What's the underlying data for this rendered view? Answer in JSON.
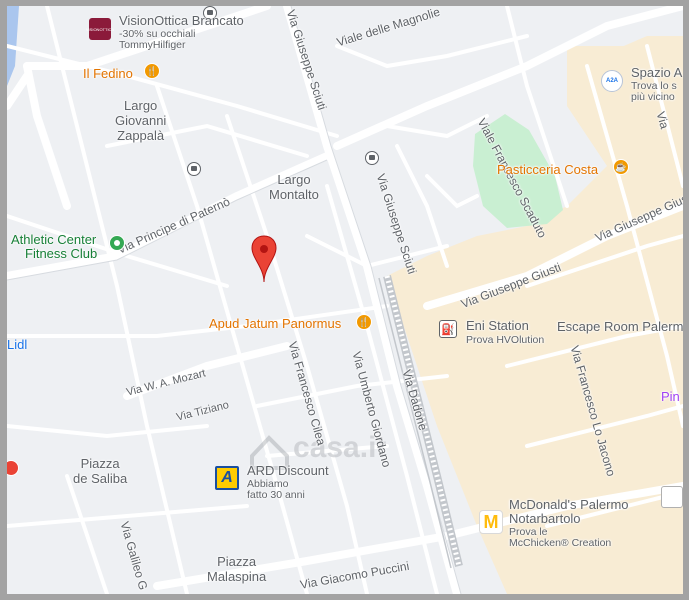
{
  "streets": {
    "viale_delle_magnolie": "Viale delle Magnolie",
    "via_giuseppe_sciuti_top": "Via Giuseppe Sciuti",
    "via_giuseppe_sciuti_mid": "Via Giuseppe Sciuti",
    "via_principe_di_paterno": "Via Principe di Paternò",
    "viale_francesco_scaduto": "Viale Francesco Scaduto",
    "via_giuseppe_giusti": "Via Giuseppe Giusti",
    "via_francesco_cilea": "Via Francesco Cilea",
    "via_umberto_giordano": "Via Umberto Giordano",
    "via_dadone": "Via Dadone",
    "via_w_a_mozart": "Via W. A. Mozart",
    "via_tiziano": "Via Tiziano",
    "via_francesco_lo_jacono": "Via Francesco Lo Jacono",
    "via_giacomo_puccini": "Via Giacomo Puccini",
    "via_galileo": "Via Galileo G",
    "via_right_edge": "Via"
  },
  "areas": {
    "largo_giovanni_zappala": [
      "Largo",
      "Giovanni",
      "Zappalà"
    ],
    "largo_montalto": [
      "Largo",
      "Montalto"
    ],
    "piazza_de_saliba": [
      "Piazza",
      "de Saliba"
    ],
    "piazza_malaspina": [
      "Piazza",
      "Malaspina"
    ]
  },
  "pois": {
    "vision_ottica": {
      "name": "VisionOttica Brancato",
      "sub1": "-30% su occhiali",
      "sub2": "TommyHilfiger",
      "logo_text": "VISIONOTTICA"
    },
    "il_fedino": {
      "name": "Il Fedino"
    },
    "spazio": {
      "name": "Spazio A",
      "sub1": "Trova lo s",
      "sub2": "più vicino",
      "logo_text": "A2A"
    },
    "pasticceria_costa": {
      "name": "Pasticceria Costa"
    },
    "athletic_center": {
      "name1": "Athletic Center",
      "name2": "Fitness Club"
    },
    "apud_jatum": {
      "name": "Apud Jatum Panormus"
    },
    "eni_station": {
      "name": "Eni Station",
      "sub": "Prova HVOlution"
    },
    "escape_room": {
      "name": "Escape Room Palerm"
    },
    "lidl": {
      "name": "Lidl"
    },
    "ard_discount": {
      "name": "ARD Discount",
      "sub1": "Abbiamo",
      "sub2": "fatto 30 anni",
      "logo_text": "A"
    },
    "mcdonalds": {
      "name1": "McDonald's Palermo",
      "name2": "Notarbartolo",
      "sub1": "Prova le",
      "sub2": "McChicken® Creation",
      "logo_text": "M"
    },
    "pin_edge": {
      "name": "Pin"
    }
  },
  "watermark": "casa.it",
  "colors": {
    "background": "#eef0f3",
    "road": "#ffffff",
    "commercial": "#f8ecd4",
    "park": "#c9efd2",
    "marker": "#ea4335",
    "poi_orange": "#e37400",
    "poi_green": "#188038",
    "rail": "#c3c7cc"
  }
}
